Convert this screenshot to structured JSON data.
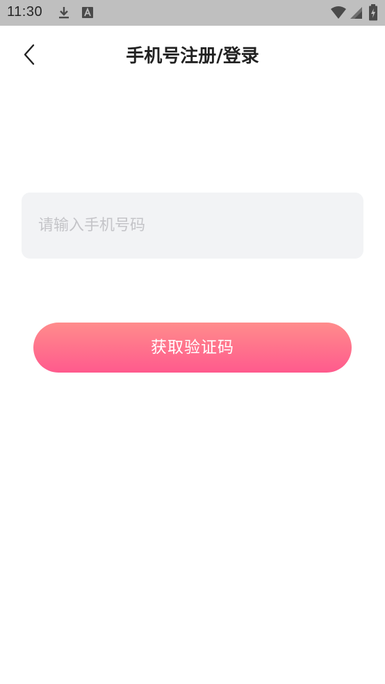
{
  "status_bar": {
    "time": "11:30",
    "icons": [
      "download-icon",
      "a-notification-icon",
      "wifi-icon",
      "signal-icon",
      "battery-icon"
    ],
    "background": "#bfbfbf"
  },
  "header": {
    "back_icon": "chevron-left-icon",
    "title": "手机号注册/登录"
  },
  "form": {
    "phone_placeholder": "请输入手机号码",
    "phone_value": "",
    "submit_label": "获取验证码",
    "button_gradient": [
      "#ff8c8c",
      "#ff5a8d"
    ]
  }
}
